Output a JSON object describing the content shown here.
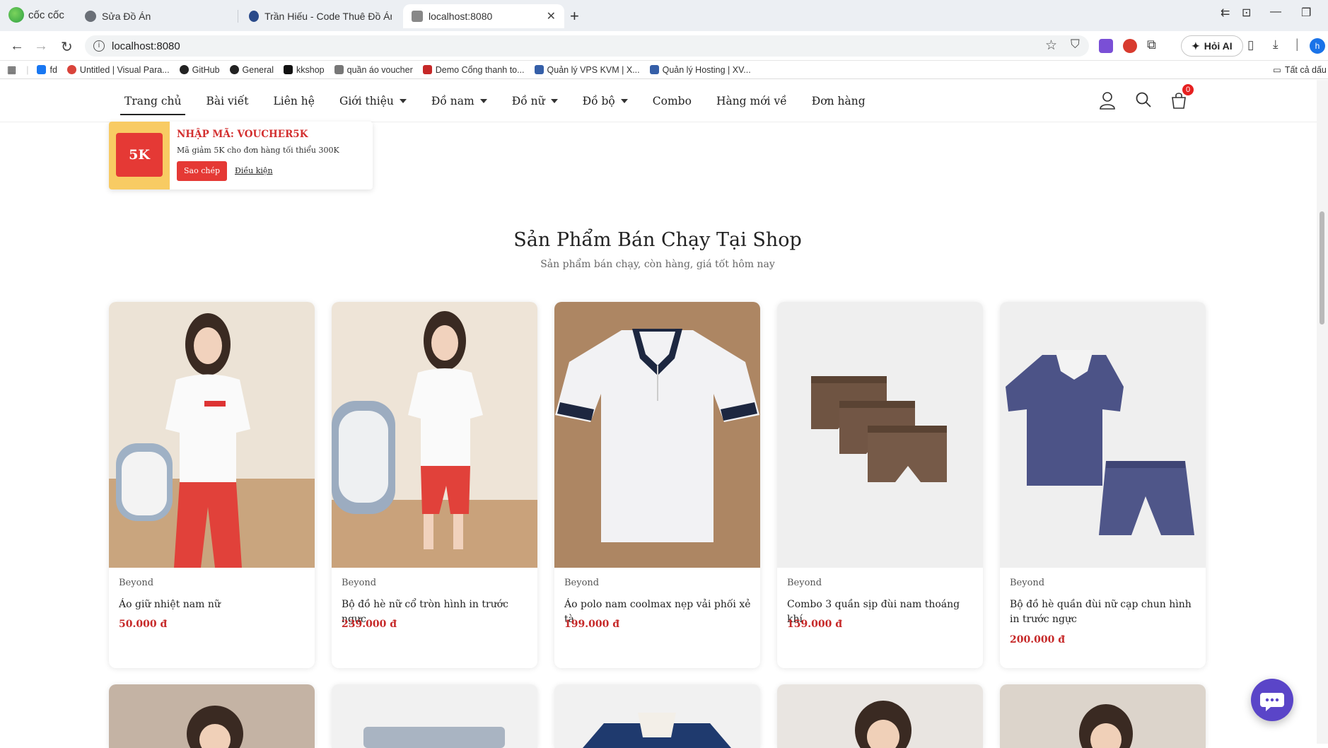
{
  "browser": {
    "brand": "cốc cốc",
    "tabs": [
      {
        "title": "Sửa Đồ Án"
      },
      {
        "title": "Trần Hiếu - Code Thuê Đồ Án - J"
      },
      {
        "title": "localhost:8080"
      }
    ],
    "url": "localhost:8080",
    "hoi_ai": "Hỏi AI",
    "profile_initial": "h",
    "bookmarks": [
      {
        "label": "fd",
        "icon": "facebook-icon"
      },
      {
        "label": "Untitled | Visual Para...",
        "icon": "visual-paradigm-icon"
      },
      {
        "label": "GitHub",
        "icon": "github-icon"
      },
      {
        "label": "General",
        "icon": "github-icon"
      },
      {
        "label": "kkshop",
        "icon": "kkshop-icon"
      },
      {
        "label": "quần áo voucher",
        "icon": "shop-icon"
      },
      {
        "label": "Demo Cổng thanh to...",
        "icon": "vnpay-icon"
      },
      {
        "label": "Quản lý VPS KVM | X...",
        "icon": "server-icon"
      },
      {
        "label": "Quản lý Hosting | XV...",
        "icon": "server-icon"
      }
    ],
    "all_bookmarks": "Tất cả dấu"
  },
  "nav": {
    "items": [
      {
        "label": "Trang chủ",
        "dropdown": false
      },
      {
        "label": "Bài viết",
        "dropdown": false
      },
      {
        "label": "Liên hệ",
        "dropdown": false
      },
      {
        "label": "Giới thiệu",
        "dropdown": true
      },
      {
        "label": "Đồ nam",
        "dropdown": true
      },
      {
        "label": "Đồ nữ",
        "dropdown": true
      },
      {
        "label": "Đồ bộ",
        "dropdown": true
      },
      {
        "label": "Combo",
        "dropdown": false
      },
      {
        "label": "Hàng mới về",
        "dropdown": false
      },
      {
        "label": "Đơn hàng",
        "dropdown": false
      }
    ],
    "cart_count": "0"
  },
  "voucher": {
    "badge": "5K",
    "title": "NHẬP MÃ: VOUCHER5K",
    "desc": "Mã giảm 5K cho đơn hàng tối thiểu 300K",
    "copy_label": "Sao chép",
    "cond_label": "Điều kiện"
  },
  "section": {
    "title": "Sản Phẩm Bán Chạy Tại Shop",
    "subtitle": "Sản phẩm bán chạy, còn hàng, giá tốt hôm nay"
  },
  "products": [
    {
      "brand": "Beyond",
      "name": "Áo giữ nhiệt nam nữ",
      "price": "50.000 đ"
    },
    {
      "brand": "Beyond",
      "name": "Bộ đồ hè nữ cổ tròn hình in trước ngực",
      "price": "239.000 đ"
    },
    {
      "brand": "Beyond",
      "name": "Áo polo nam coolmax nẹp vải phối xẻ tà",
      "price": "199.000 đ"
    },
    {
      "brand": "Beyond",
      "name": "Combo 3 quần sịp đùi nam thoáng khí",
      "price": "159.000 đ"
    },
    {
      "brand": "Beyond",
      "name": "Bộ đồ hè quần đùi nữ cạp chun hình in trước ngực",
      "price": "200.000 đ"
    }
  ],
  "colors": {
    "accent_red": "#e53935",
    "price_red": "#c62828",
    "voucher_yellow": "#f8cb63",
    "chat_purple": "#5a45c8"
  }
}
